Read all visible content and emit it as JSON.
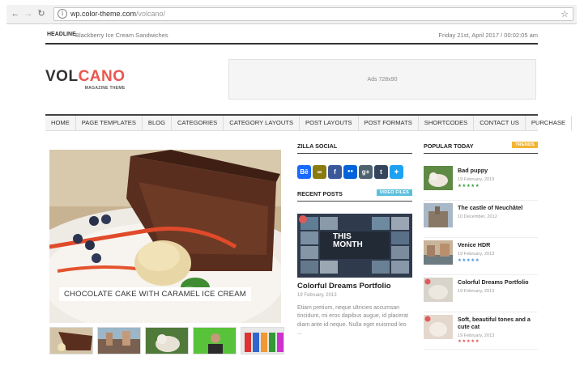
{
  "browser": {
    "back_icon": "arrow-left-icon",
    "forward_icon": "arrow-right-icon",
    "reload_icon": "reload-icon",
    "url_host": "wp.color-theme.com",
    "url_path": "/volcano/",
    "bookmark_icon": "star-icon"
  },
  "topbar": {
    "headline_tag": "HEADLINE",
    "headline_text": "Blackberry Ice Cream Sandwiches",
    "date": "Friday 21st, April 2017 / 00:02:05 am"
  },
  "logo": {
    "part1": "VOL",
    "part2": "CANO",
    "tagline": "MAGAZINE THEME"
  },
  "ad": {
    "label": "Ads 728x90"
  },
  "menu": [
    "HOME",
    "PAGE TEMPLATES",
    "BLOG",
    "CATEGORIES",
    "CATEGORY LAYOUTS",
    "POST LAYOUTS",
    "POST FORMATS",
    "SHORTCODES",
    "CONTACT US",
    "PURCHASE"
  ],
  "featured": {
    "caption": "CHOCOLATE CAKE WITH CARAMEL ICE CREAM"
  },
  "social": {
    "title": "ZILLA SOCIAL",
    "icons": [
      {
        "label": "Bē",
        "color": "#1769ff",
        "icon": "behance-icon"
      },
      {
        "label": "∞",
        "color": "#8a7a12",
        "icon": "digg-icon"
      },
      {
        "label": "f",
        "color": "#3b5998",
        "icon": "facebook-icon"
      },
      {
        "label": "●●",
        "color": "#0063dc",
        "icon": "flickr-icon"
      },
      {
        "label": "g+",
        "color": "#4f6270",
        "icon": "googleplus-icon"
      },
      {
        "label": "t",
        "color": "#35465c",
        "icon": "tumblr-icon"
      },
      {
        "label": "✦",
        "color": "#1da1f2",
        "icon": "twitter-icon"
      }
    ]
  },
  "recent": {
    "title": "RECENT POSTS",
    "badge": "VIDEO FILES",
    "badge_color": "#5bc0de",
    "post_overlay_line1": "THIS",
    "post_overlay_line2": "MONTH",
    "post_title": "Colorful Dreams Portfolio",
    "post_date": "19 February, 2013",
    "post_text": "Etiam pretium, neque ultricies accumsan tincidunt, mi eros dapibus augue, id placerat diam ante id neque. Nulla eget euismod leo ..."
  },
  "popular": {
    "title": "POPULAR TODAY",
    "badge": "TRENDS",
    "badge_color": "#f2b632",
    "items": [
      {
        "title": "Bad puppy",
        "date": "19 February, 2013",
        "stars": "★★★★★",
        "star_color": "#3a9b3a",
        "thumb": "puppy"
      },
      {
        "title": "The castle of Neuchâtel",
        "date": "10 December, 2012",
        "stars": "",
        "star_color": "",
        "thumb": "castle"
      },
      {
        "title": "Venice HDR",
        "date": "19 February, 2013",
        "stars": "★★★★★",
        "star_color": "#4a8fd4",
        "thumb": "venice"
      },
      {
        "title": "Colorful Dreams Portfolio",
        "date": "19 February, 2013",
        "stars": "",
        "star_color": "",
        "thumb": "portfolio"
      },
      {
        "title": "Soft, beautiful tones and a cute cat",
        "date": "19 February, 2013",
        "stars": "★★★★★",
        "star_color": "#e05a5a",
        "thumb": "cat"
      }
    ]
  }
}
